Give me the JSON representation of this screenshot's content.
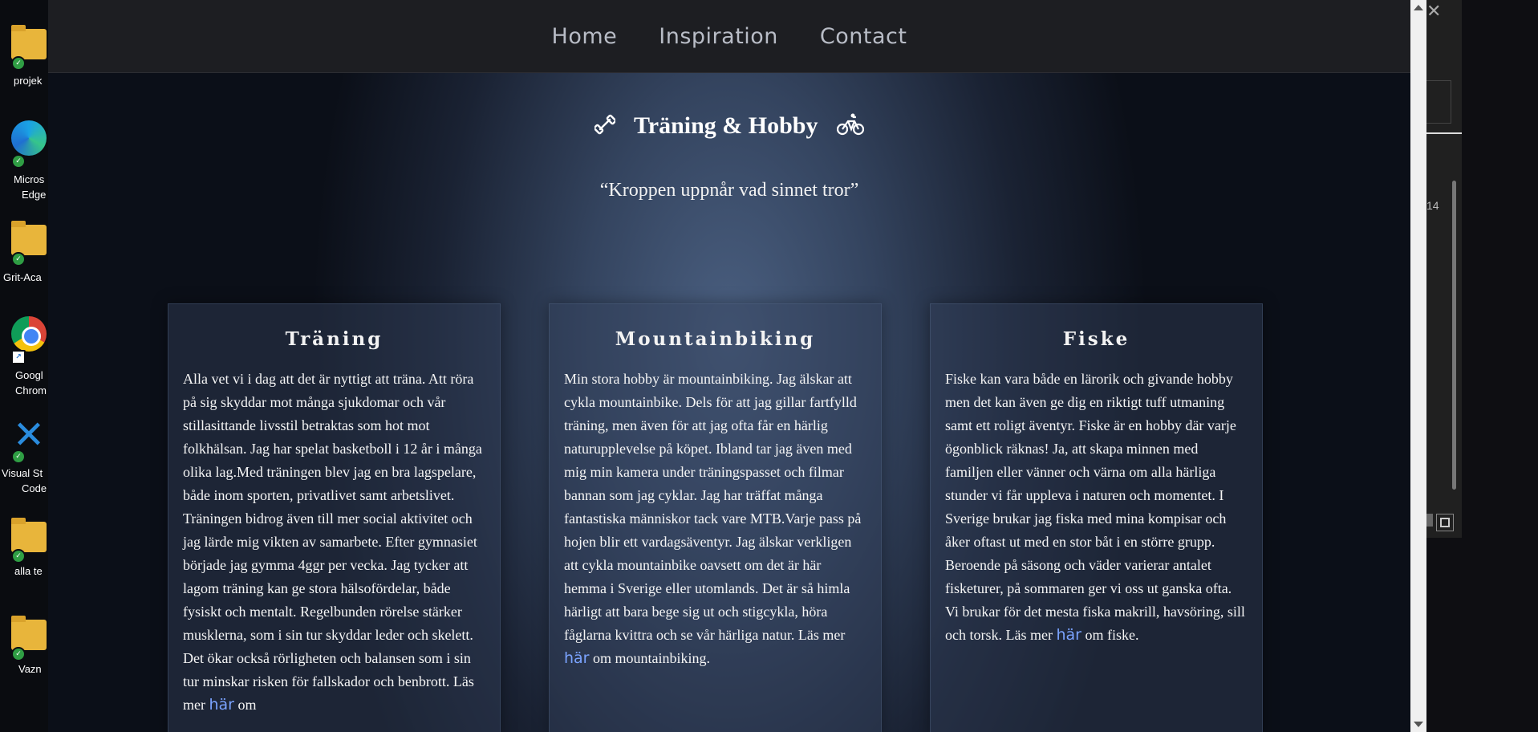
{
  "desktop": {
    "icons": [
      {
        "label_1": "projek",
        "label_2": ""
      },
      {
        "label_1": "Micros",
        "label_2": "Edge"
      },
      {
        "label_1": "Grit-Aca",
        "label_2": ""
      },
      {
        "label_1": "Googl",
        "label_2": "Chrom"
      },
      {
        "label_1": "Visual St",
        "label_2": "Code"
      },
      {
        "label_1": "alla te",
        "label_2": ""
      },
      {
        "label_1": "Vazn",
        "label_2": ""
      }
    ]
  },
  "background_window": {
    "fragment": "14"
  },
  "nav": {
    "items": [
      "Home",
      "Inspiration",
      "Contact"
    ]
  },
  "hero": {
    "title": "Träning & Hobby",
    "quote": "“Kroppen uppnår vad sinnet tror”",
    "left_icon": "dumbbell-icon",
    "right_icon": "bicycle-icon"
  },
  "cards": [
    {
      "title": "Träning",
      "text": "Alla vet vi i dag att det är nyttigt att träna. Att röra på sig skyddar mot många sjukdomar och vår stillasittande livsstil betraktas som hot mot folkhälsan. Jag har spelat basketboll i 12 år i många olika lag.Med träningen blev jag en bra lagspelare, både inom sporten, privatlivet samt arbetslivet. Träningen bidrog även till mer social aktivitet och jag lärde mig vikten av samarbete. Efter gymnasiet började jag gymma 4ggr per vecka. Jag tycker att lagom träning kan ge stora hälsofördelar, både fysiskt och mentalt. Regelbunden rörelse stärker musklerna, som i sin tur skyddar leder och skelett. Det ökar också rörligheten och balansen som i sin tur minskar risken för fallskador och benbrott. Läs mer",
      "link": "här",
      "after": "om"
    },
    {
      "title": "Mountainbiking",
      "text": "Min stora hobby är mountainbiking. Jag älskar att cykla mountainbike. Dels för att jag gillar fartfylld träning, men även för att jag ofta får en härlig naturupplevelse på köpet. Ibland tar jag även med mig min kamera under träningspasset och filmar bannan som jag cyklar. Jag har träffat många fantastiska människor tack vare MTB.Varje pass på hojen blir ett vardagsäventyr. Jag älskar verkligen att cykla mountainbike oavsett om det är här hemma i Sverige eller utomlands. Det är så himla härligt att bara bege sig ut och stigcykla, höra fåglarna kvittra och se vår härliga natur. Läs mer",
      "link": "här",
      "after": "om mountainbiking."
    },
    {
      "title": "Fiske",
      "text": "Fiske kan vara både en lärorik och givande hobby men det kan även ge dig en riktigt tuff utmaning samt ett roligt äventyr. Fiske är en hobby där varje ögonblick räknas! Ja, att skapa minnen med familjen eller vänner och värna om alla härliga stunder vi får uppleva i naturen och momentet. I Sverige brukar jag fiska med mina kompisar och åker oftast ut med en stor båt i en större grupp. Beroende på säsong och väder varierar antalet fisketurer, på sommaren ger vi oss ut ganska ofta. Vi brukar för det mesta fiska makrill, havsöring, sill och torsk. Läs mer",
      "link": "här",
      "after": "om fiske."
    }
  ],
  "colors": {
    "link": "#7aa3ff",
    "nav_text": "#b8bcc6",
    "nav_bg": "#1d1e22"
  }
}
